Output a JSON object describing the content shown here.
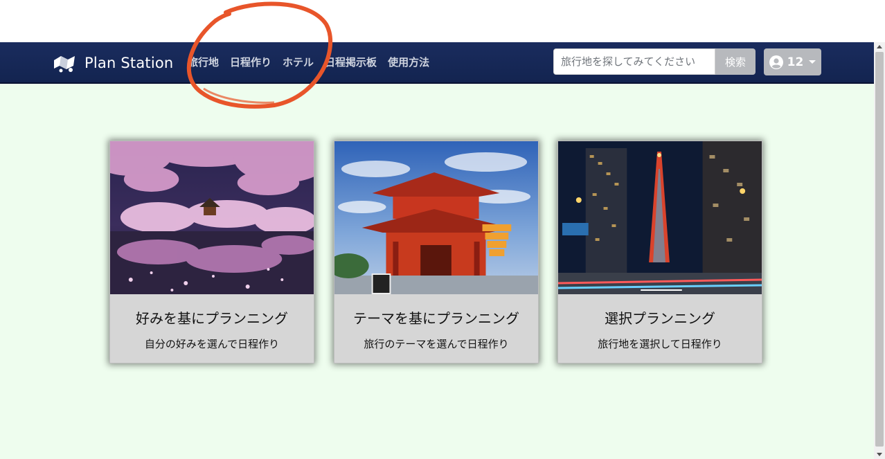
{
  "brand": {
    "name": "Plan Station",
    "logo_icon": "map-logo-icon"
  },
  "nav": {
    "items": [
      {
        "label": "旅行地"
      },
      {
        "label": "日程作り"
      },
      {
        "label": "ホテル"
      },
      {
        "label": "日程掲示板"
      },
      {
        "label": "使用方法"
      }
    ]
  },
  "search": {
    "placeholder": "旅行地を探してみてください",
    "button_label": "検索"
  },
  "user": {
    "icon": "user-circle-icon",
    "count": "12"
  },
  "cards": [
    {
      "title": "好みを基にプランニング",
      "description": "自分の好みを選んで日程作り",
      "image": "cherry-blossom-temple-night"
    },
    {
      "title": "テーマを基にプランニング",
      "description": "旅行のテーマを選んで日程作り",
      "image": "red-temple-gate"
    },
    {
      "title": "選択プランニング",
      "description": "旅行地を選択して日程作り",
      "image": "tokyo-tower-night-street"
    }
  ],
  "colors": {
    "navbar": "#1a2c5e",
    "content_bg": "#eefdee",
    "card_bg": "#d6d6d6",
    "annotation": "#e8552a"
  }
}
